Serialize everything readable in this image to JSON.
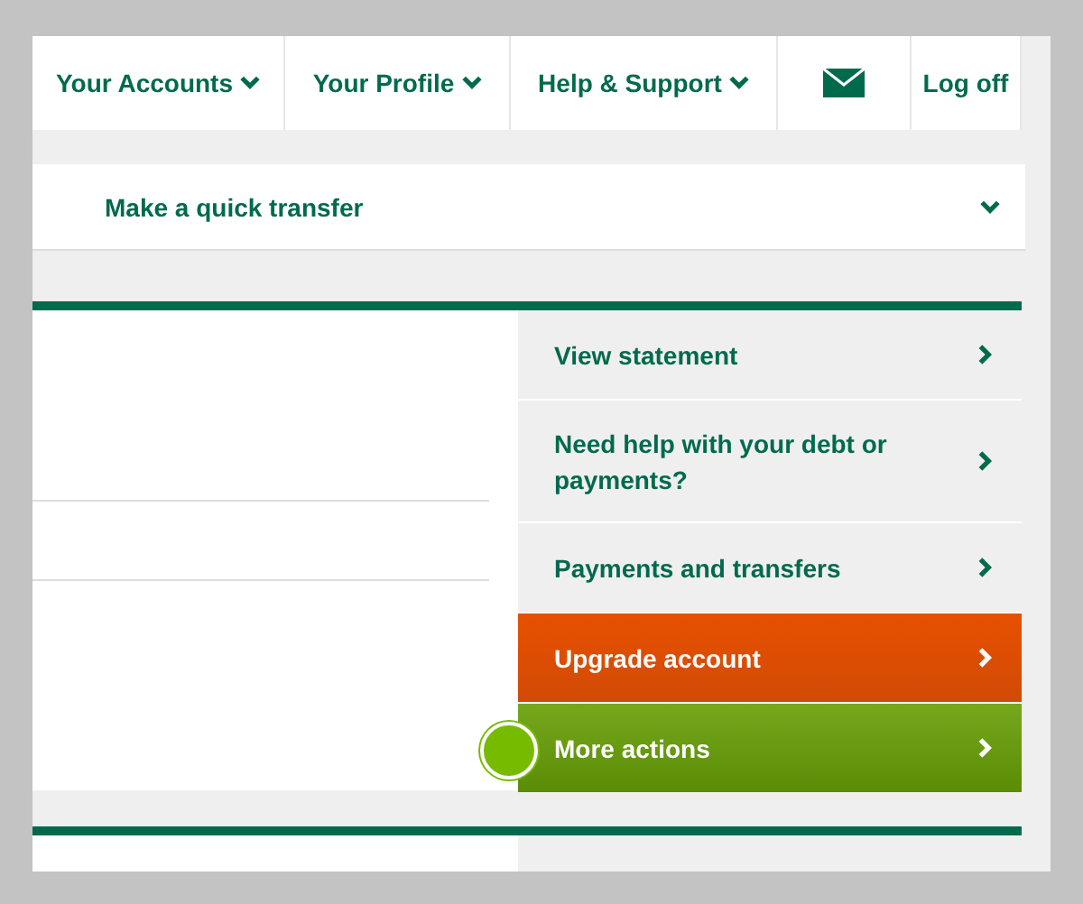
{
  "nav": [
    {
      "kind": "menu",
      "label": "Your Accounts"
    },
    {
      "kind": "menu",
      "label": "Your Profile"
    },
    {
      "kind": "menu",
      "label": "Help & Support"
    },
    {
      "kind": "mail"
    },
    {
      "kind": "link",
      "label": "Log off"
    }
  ],
  "quick_transfer": {
    "label": "Make a quick transfer",
    "expanded": false
  },
  "actions": [
    {
      "kind": "plain",
      "label": "View statement"
    },
    {
      "kind": "plain",
      "label": "Need help with your debt or payments?"
    },
    {
      "kind": "plain",
      "label": "Payments and transfers"
    },
    {
      "kind": "upgrade",
      "label": "Upgrade account"
    },
    {
      "kind": "more",
      "label": "More actions"
    }
  ]
}
